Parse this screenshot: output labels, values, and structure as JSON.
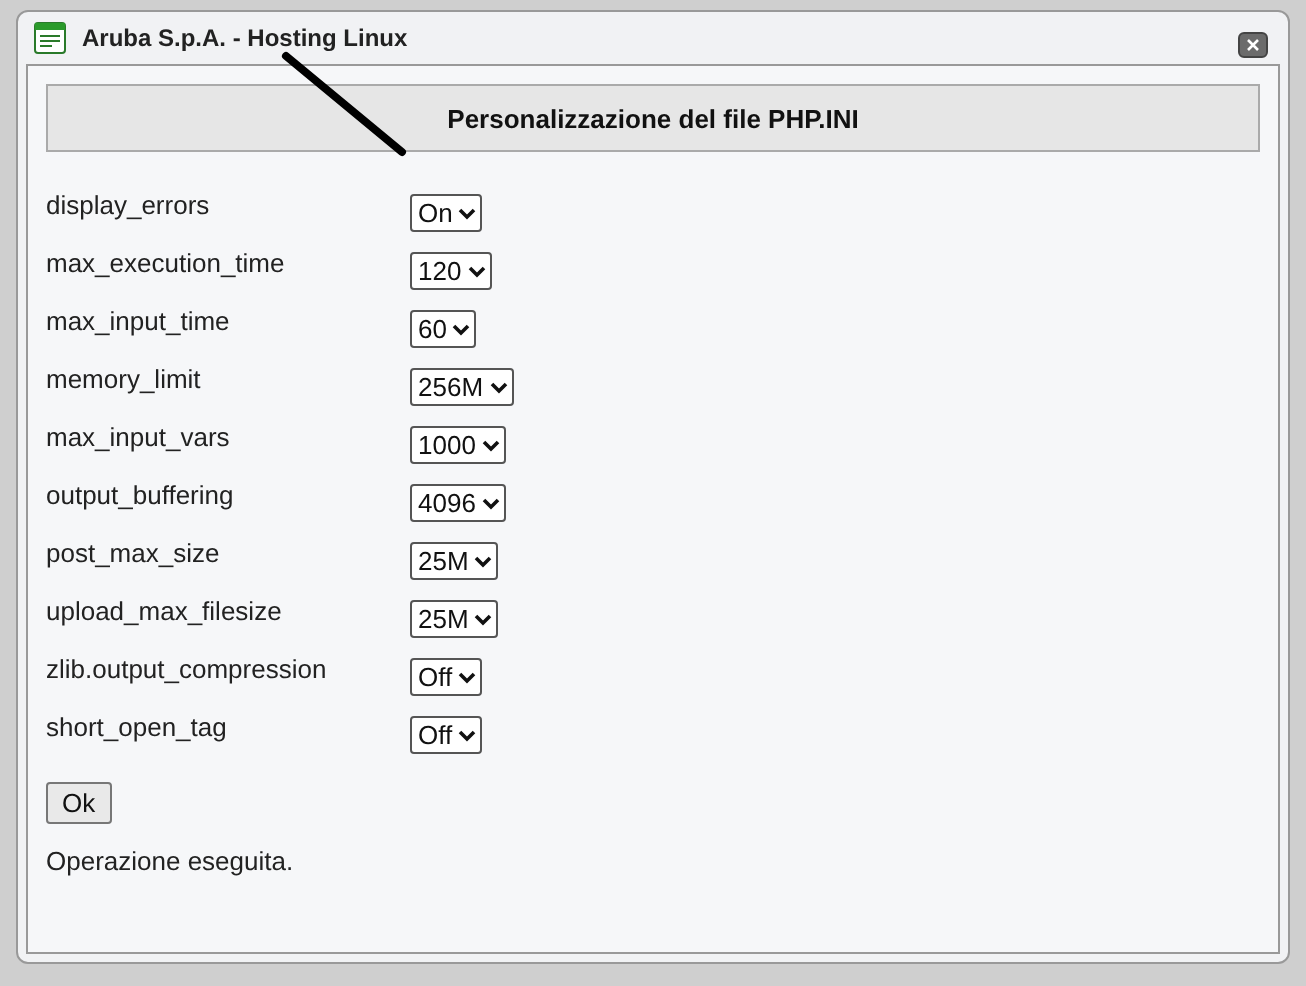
{
  "window": {
    "title": "Aruba S.p.A. - Hosting Linux"
  },
  "header": "Personalizzazione del file PHP.INI",
  "settings": [
    {
      "label": "display_errors",
      "value": "On"
    },
    {
      "label": "max_execution_time",
      "value": "120"
    },
    {
      "label": "max_input_time",
      "value": "60"
    },
    {
      "label": "memory_limit",
      "value": "256M"
    },
    {
      "label": "max_input_vars",
      "value": "1000"
    },
    {
      "label": "output_buffering",
      "value": "4096"
    },
    {
      "label": "post_max_size",
      "value": "25M"
    },
    {
      "label": "upload_max_filesize",
      "value": "25M"
    },
    {
      "label": "zlib.output_compression",
      "value": "Off"
    },
    {
      "label": "short_open_tag",
      "value": "Off"
    }
  ],
  "button": "Ok",
  "status": "Operazione eseguita."
}
